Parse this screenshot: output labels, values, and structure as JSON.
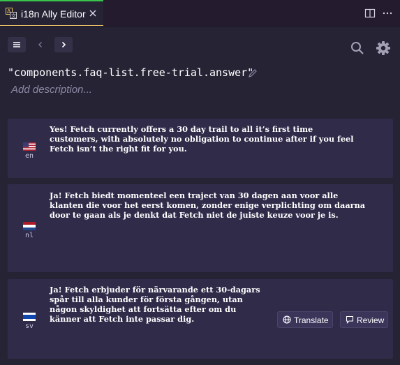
{
  "tab": {
    "title": "i18n Ally Editor",
    "icon": "translate-icon"
  },
  "toolbar": {
    "icons": [
      "menu-icon",
      "chevron-left-icon",
      "chevron-right-icon",
      "search-icon",
      "gear-icon"
    ]
  },
  "key": {
    "title": "\"components.faq-list.free-trial.answer\"",
    "description_placeholder": "Add description..."
  },
  "translations": [
    {
      "lang": "en",
      "text": "Yes! Fetch currently offers a 30 day trail to all it’s first time\ncustomers, with absolutely no obligation to continue after if you feel\nFetch isn’t the right fit for you."
    },
    {
      "lang": "nl",
      "text": "Ja! Fetch biedt momenteel een traject van 30 dagen aan voor alle\nklanten die voor het eerst komen, zonder enige verplichting om daarna\ndoor te gaan als je denkt dat Fetch niet de juiste keuze voor je is."
    },
    {
      "lang": "sv",
      "text": "Ja! Fetch erbjuder för närvarande ett 30-dagars\nspår till alla kunder för första gången, utan\nnågon skyldighet att fortsätta efter om du\nkänner att Fetch inte passar dig."
    }
  ],
  "actions": {
    "translate_label": "Translate",
    "review_label": "Review"
  },
  "colors": {
    "accent_tab": "#39c54c",
    "card_bg": "#312b4a",
    "page_bg": "#262335"
  }
}
